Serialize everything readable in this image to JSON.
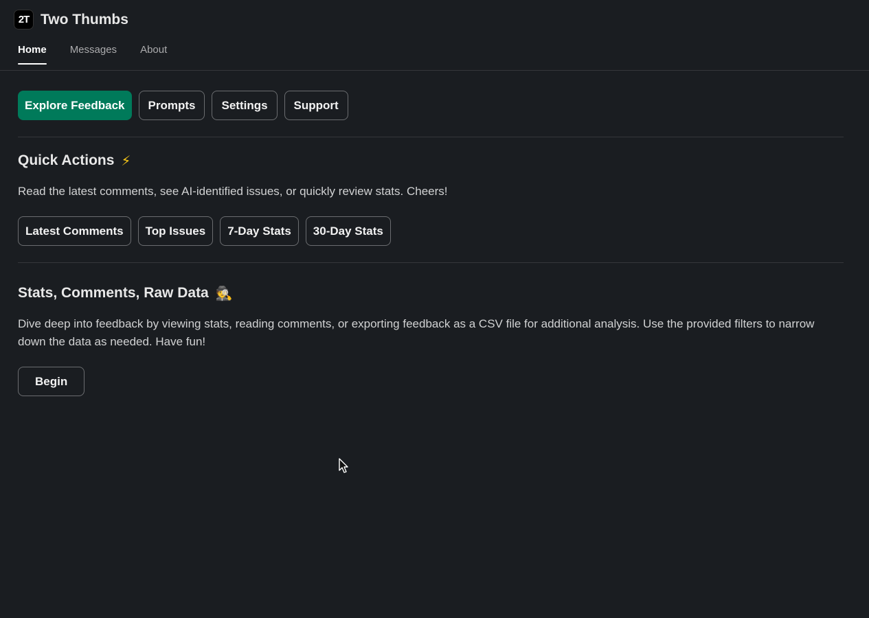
{
  "app": {
    "title": "Two Thumbs",
    "logo_text": "2T",
    "logo_icon": "two-thumbs-logo-icon"
  },
  "tabs": [
    {
      "label": "Home",
      "active": true
    },
    {
      "label": "Messages",
      "active": false
    },
    {
      "label": "About",
      "active": false
    }
  ],
  "nav_buttons": {
    "explore_feedback": "Explore Feedback",
    "prompts": "Prompts",
    "settings": "Settings",
    "support": "Support"
  },
  "quick_actions": {
    "title": "Quick Actions",
    "emoji": "⚡",
    "description": "Read the latest comments, see AI-identified issues, or quickly review stats. Cheers!",
    "buttons": {
      "latest_comments": "Latest Comments",
      "top_issues": "Top Issues",
      "seven_day_stats": "7-Day Stats",
      "thirty_day_stats": "30-Day Stats"
    }
  },
  "raw_data": {
    "title": "Stats, Comments, Raw Data",
    "emoji": "🕵",
    "description": "Dive deep into feedback by viewing stats, reading comments, or exporting feedback as a CSV file for additional analysis. Use the provided filters to narrow down the data as needed. Have fun!",
    "begin_label": "Begin"
  },
  "colors": {
    "background": "#1a1d21",
    "primary_button": "#007a5a",
    "divider": "#35373b",
    "text": "#d1d2d3"
  }
}
